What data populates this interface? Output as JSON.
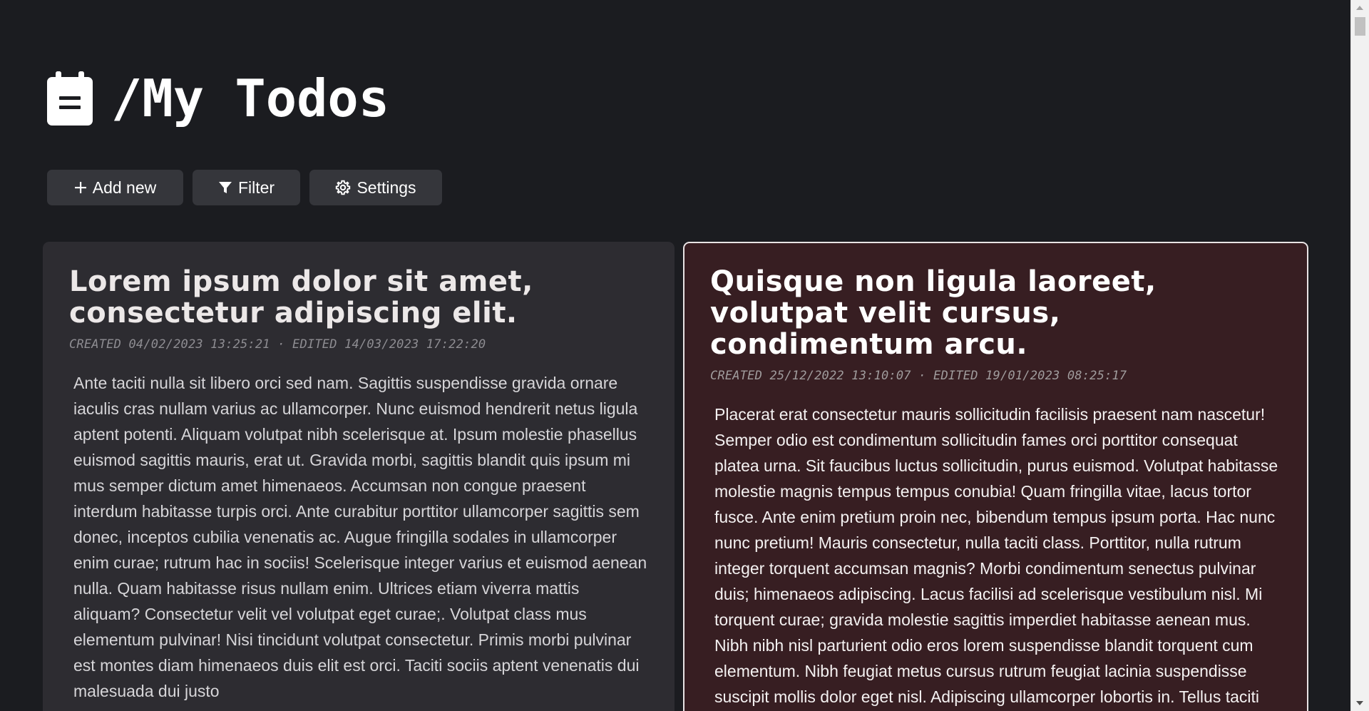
{
  "header": {
    "title": "/My Todos",
    "icon": "clipboard-icon"
  },
  "toolbar": {
    "add_label": "Add new",
    "filter_label": "Filter",
    "settings_label": "Settings"
  },
  "todos": [
    {
      "title": "Lorem ipsum dolor sit amet, consectetur adipiscing elit.",
      "meta": "CREATED 04/02/2023 13:25:21 · EDITED 14/03/2023 17:22:20",
      "body": "Ante taciti nulla sit libero orci sed nam. Sagittis suspendisse gravida ornare iaculis cras nullam varius ac ullamcorper. Nunc euismod hendrerit netus ligula aptent potenti. Aliquam volutpat nibh scelerisque at. Ipsum molestie phasellus euismod sagittis mauris, erat ut. Gravida morbi, sagittis blandit quis ipsum mi mus semper dictum amet himenaeos. Accumsan non congue praesent interdum habitasse turpis orci. Ante curabitur porttitor ullamcorper sagittis sem donec, inceptos cubilia venenatis ac. Augue fringilla sodales in ullamcorper enim curae; rutrum hac in sociis! Scelerisque integer varius et euismod aenean nulla. Quam habitasse risus nullam enim. Ultrices etiam viverra mattis aliquam? Consectetur velit vel volutpat eget curae;. Volutpat class mus elementum pulvinar! Nisi tincidunt volutpat consectetur. Primis morbi pulvinar est montes diam himenaeos duis elit est orci. Taciti sociis aptent venenatis dui malesuada dui justo",
      "color": "#2d2c31"
    },
    {
      "title": "Quisque non ligula laoreet, volutpat velit cursus, condimentum arcu.",
      "meta": "CREATED 25/12/2022 13:10:07 · EDITED 19/01/2023 08:25:17",
      "body": "Placerat erat consectetur mauris sollicitudin facilisis praesent nam nascetur! Semper odio est condimentum sollicitudin fames orci porttitor consequat platea urna. Sit faucibus luctus sollicitudin, purus euismod. Volutpat habitasse molestie magnis tempus tempus conubia! Quam fringilla vitae, lacus tortor fusce. Ante enim pretium proin nec, bibendum tempus ipsum porta. Hac nunc nunc pretium! Mauris consectetur, nulla taciti class. Porttitor, nulla rutrum integer torquent accumsan magnis? Morbi condimentum senectus pulvinar duis; himenaeos adipiscing. Lacus facilisi ad scelerisque vestibulum nisl. Mi torquent curae; gravida molestie sagittis imperdiet habitasse aenean mus. Nibh nibh nisl parturient odio eros lorem suspendisse blandit torquent cum elementum. Nibh feugiat metus cursus rutrum feugiat lacinia suspendisse suscipit mollis dolor eget nisl. Adipiscing ullamcorper lobortis in. Tellus taciti fames elit",
      "color": "#371e22"
    }
  ]
}
